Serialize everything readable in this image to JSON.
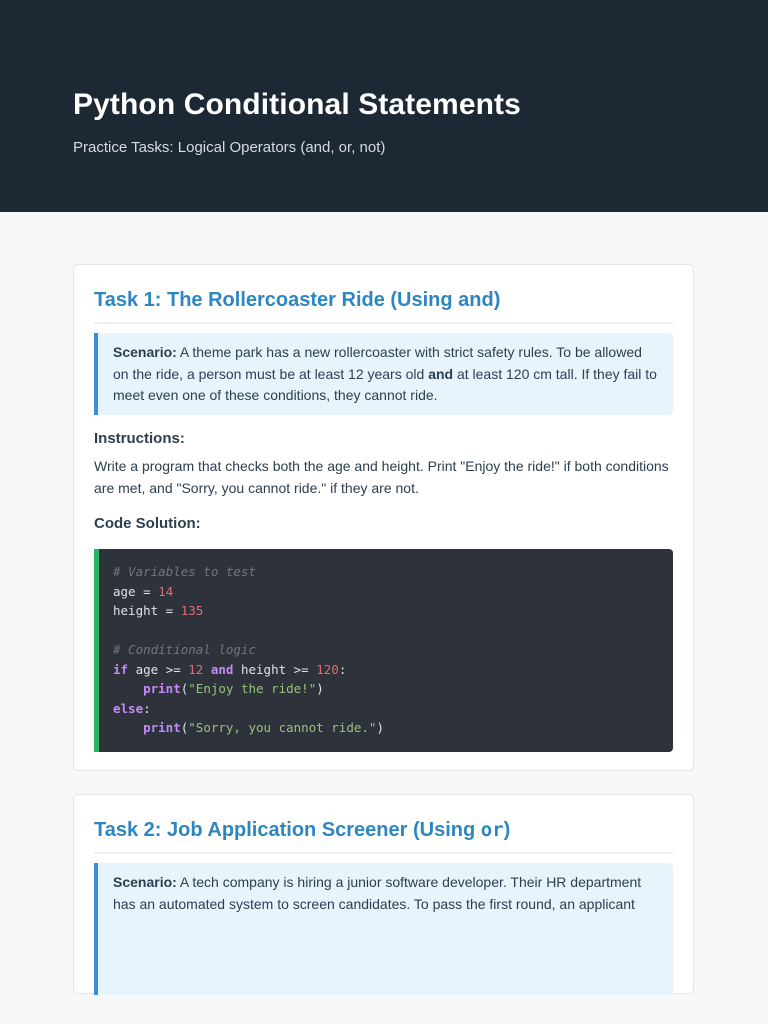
{
  "header": {
    "title": "Python Conditional Statements",
    "subtitle": "Practice Tasks: Logical Operators (and, or, not)"
  },
  "task1": {
    "title": "Task 1: The Rollercoaster Ride (Using and)",
    "scenario_label": "Scenario:",
    "scenario_before": " A theme park has a new rollercoaster with strict safety rules. To be allowed on the ride, a person must be at least 12 years old ",
    "scenario_bold": "and",
    "scenario_after": " at least 120 cm tall. If they fail to meet even one of these conditions, they cannot ride.",
    "instructions_heading": "Instructions:",
    "instructions_text": "Write a program that checks both the age and height. Print \"Enjoy the ride!\" if both conditions are met, and \"Sorry, you cannot ride.\" if they are not.",
    "code_heading": "Code Solution:",
    "code": {
      "comment1": "# Variables to test",
      "age_var": "age",
      "age_value": "14",
      "height_var": "height",
      "height_value": "135",
      "comment2": "# Conditional logic",
      "kw_if": "if",
      "cond_age": " age >= ",
      "cond_age_value": "12",
      "kw_and": "and",
      "cond_height": " height >= ",
      "cond_height_value": "120",
      "print_fn": "print",
      "success_msg": "\"Enjoy the ride!\"",
      "kw_else": "else",
      "fail_msg": "\"Sorry, you cannot ride.\""
    }
  },
  "task2": {
    "title_prefix": "Task 2: Job Application Screener (Using ",
    "title_code": "or",
    "title_suffix": ")",
    "scenario_label": "Scenario:",
    "scenario_text": " A tech company is hiring a junior software developer. Their HR department has an automated system to screen candidates. To pass the first round, an applicant"
  }
}
